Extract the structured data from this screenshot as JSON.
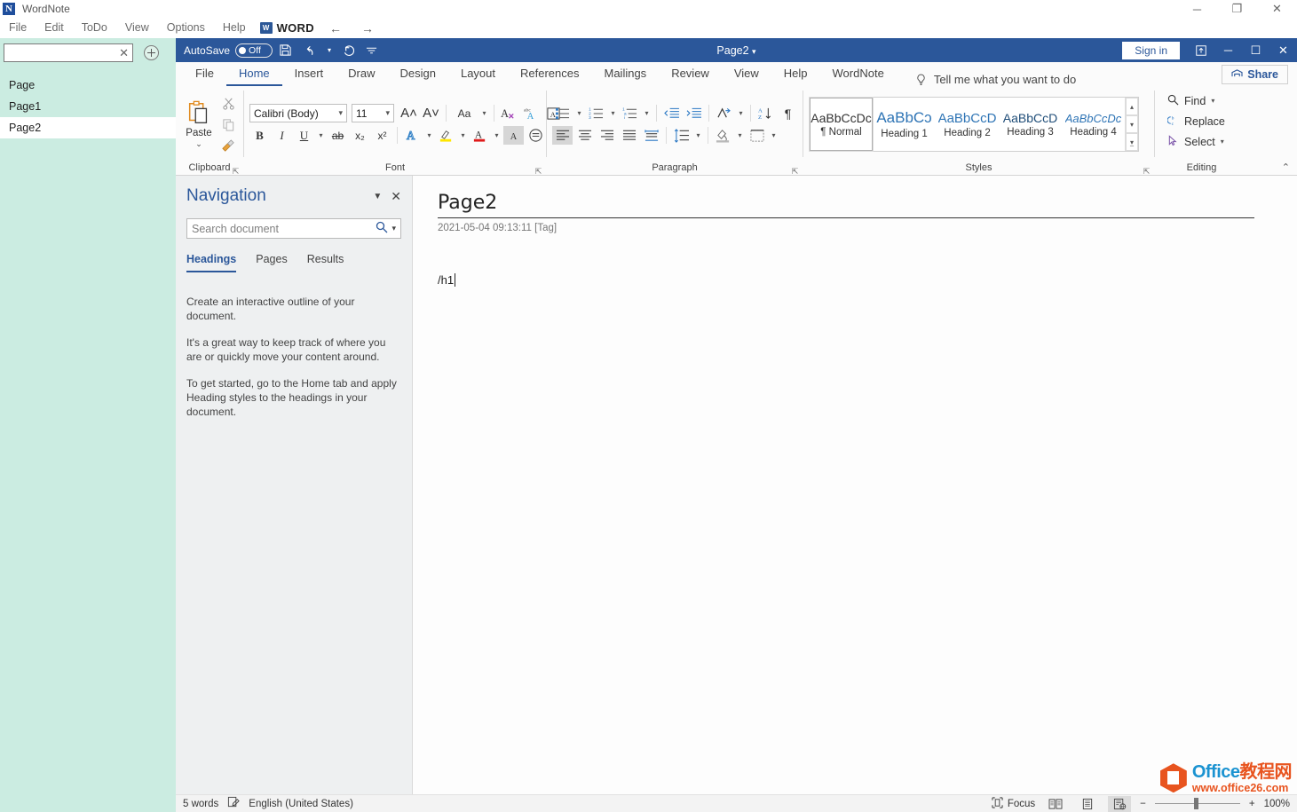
{
  "app": {
    "name": "WordNote",
    "logo_letter": "N",
    "menu": [
      "File",
      "Edit",
      "ToDo",
      "View",
      "Options",
      "Help"
    ],
    "word_chip": {
      "icon": "word-icon",
      "label": "WORD"
    },
    "nav_back": "←",
    "nav_forward": "→",
    "window_buttons": {
      "minimize": "─",
      "restore": "❐",
      "close": "✕"
    }
  },
  "sidebar": {
    "search": {
      "value": "",
      "placeholder": "",
      "clear_icon": "close-icon"
    },
    "add_button_icon": "plus-circle-icon",
    "items": [
      {
        "label": "Page",
        "selected": false
      },
      {
        "label": "Page1",
        "selected": false
      },
      {
        "label": "Page2",
        "selected": true
      }
    ]
  },
  "word": {
    "titlebar": {
      "autosave_label": "AutoSave",
      "autosave_state": "Off",
      "qat": [
        "save-icon",
        "undo-icon",
        "redo-icon",
        "customize-qat-icon"
      ],
      "document_title": "Page2",
      "title_dropdown": "▾",
      "sign_in": "Sign in",
      "ribbon_display_icon": "ribbon-display-options-icon",
      "minimize": "─",
      "maximize": "☐",
      "close": "✕"
    },
    "tabs": [
      {
        "label": "File",
        "active": false
      },
      {
        "label": "Home",
        "active": true
      },
      {
        "label": "Insert",
        "active": false
      },
      {
        "label": "Draw",
        "active": false
      },
      {
        "label": "Design",
        "active": false
      },
      {
        "label": "Layout",
        "active": false
      },
      {
        "label": "References",
        "active": false
      },
      {
        "label": "Mailings",
        "active": false
      },
      {
        "label": "Review",
        "active": false
      },
      {
        "label": "View",
        "active": false
      },
      {
        "label": "Help",
        "active": false
      },
      {
        "label": "WordNote",
        "active": false
      }
    ],
    "tellme": {
      "icon": "lightbulb-icon",
      "text": "Tell me what you want to do"
    },
    "share": {
      "icon": "share-icon",
      "label": "Share"
    },
    "ribbon": {
      "clipboard": {
        "group_label": "Clipboard",
        "paste_label": "Paste",
        "paste_caret": "⌄",
        "cut_icon": "scissors-icon",
        "copy_icon": "copy-icon",
        "format_painter_icon": "format-painter-icon",
        "dialog_launcher": "dialog-launcher-icon"
      },
      "font": {
        "group_label": "Font",
        "font_family": "Calibri (Body)",
        "font_size": "11",
        "grow_font": "A˄",
        "shrink_font": "A˅",
        "change_case": "Aa",
        "clear_formatting": "clear-formatting-icon",
        "phonetic_guide": "phonetic-guide-icon",
        "character_border": "character-border-icon",
        "bold": "B",
        "italic": "I",
        "underline": "U",
        "strikethrough": "ab",
        "subscript": "x₂",
        "superscript": "x²",
        "text_effects": "text-effects-icon",
        "text_highlight": "text-highlight-icon",
        "font_color": "font-color-icon",
        "character_shading": "character-shading-icon",
        "enclose_characters": "enclose-characters-icon",
        "dialog_launcher": "dialog-launcher-icon"
      },
      "paragraph": {
        "group_label": "Paragraph",
        "bullets": "bullets-icon",
        "numbering": "numbering-icon",
        "multilevel_list": "multilevel-list-icon",
        "decrease_indent": "decrease-indent-icon",
        "increase_indent": "increase-indent-icon",
        "sort": "sort-icon",
        "sort_az": "sort-az-icon",
        "show_marks": "¶",
        "align_left": "align-left-icon",
        "align_center": "align-center-icon",
        "align_right": "align-right-icon",
        "justify": "justify-icon",
        "distribute": "distribute-icon",
        "line_spacing": "line-spacing-icon",
        "shading": "shading-icon",
        "borders": "borders-icon",
        "dialog_launcher": "dialog-launcher-icon"
      },
      "styles": {
        "group_label": "Styles",
        "items": [
          {
            "preview": "AaBbCcDc",
            "name": "¶ Normal",
            "selected": true,
            "color": "#333333",
            "italic": false
          },
          {
            "preview": "AaBbCɔ",
            "name": "Heading 1",
            "selected": false,
            "color": "#2e74b5",
            "italic": false
          },
          {
            "preview": "AaBbCcD",
            "name": "Heading 2",
            "selected": false,
            "color": "#2e74b5",
            "italic": false
          },
          {
            "preview": "AaBbCcD",
            "name": "Heading 3",
            "selected": false,
            "color": "#1f4d78",
            "italic": false
          },
          {
            "preview": "AaBbCcDc",
            "name": "Heading 4",
            "selected": false,
            "color": "#2e74b5",
            "italic": true
          }
        ],
        "scroll_up": "▴",
        "scroll_down": "▾",
        "more": "▾",
        "dialog_launcher": "dialog-launcher-icon"
      },
      "editing": {
        "group_label": "Editing",
        "items": [
          {
            "label": "Find",
            "icon": "search-icon",
            "caret": "⌄"
          },
          {
            "label": "Replace",
            "icon": "replace-icon",
            "caret": ""
          },
          {
            "label": "Select",
            "icon": "select-pointer-icon",
            "caret": "⌄"
          }
        ]
      },
      "collapse_ribbon": "⌃"
    }
  },
  "navigation": {
    "title": "Navigation",
    "dropdown_icon": "chevron-down-icon",
    "close_icon": "close-icon",
    "search_placeholder": "Search document",
    "search_value": "",
    "search_icon": "search-icon",
    "search_caret": "⌄",
    "tabs": [
      {
        "label": "Headings",
        "active": true
      },
      {
        "label": "Pages",
        "active": false
      },
      {
        "label": "Results",
        "active": false
      }
    ],
    "body": [
      "Create an interactive outline of your document.",
      "It's a great way to keep track of where you are or quickly move your content around.",
      "To get started, go to the Home tab and apply Heading styles to the headings in your document."
    ]
  },
  "document": {
    "title": "Page2",
    "meta": "2021-05-04 09:13:11  [Tag]",
    "body_text": "/h1"
  },
  "statusbar": {
    "word_count": "5 words",
    "proofing_icon": "proofing-errors-icon",
    "language": "English (United States)",
    "focus_icon": "focus-icon",
    "focus_label": "Focus",
    "views": [
      {
        "icon": "read-mode-icon",
        "active": false
      },
      {
        "icon": "print-layout-icon",
        "active": false
      },
      {
        "icon": "web-layout-icon",
        "active": true
      }
    ],
    "zoom_out": "−",
    "zoom_in": "+",
    "zoom_level": "100%"
  },
  "watermark": {
    "line1_en": "Office",
    "line1_cn": "教程网",
    "line2": "www.office26.com",
    "logo_icon": "office-logo-icon"
  },
  "colors": {
    "word_blue": "#2b579a",
    "sidebar_mint": "#cbece1",
    "accent_orange": "#e8541f",
    "accent_cyan": "#1b93d1"
  }
}
